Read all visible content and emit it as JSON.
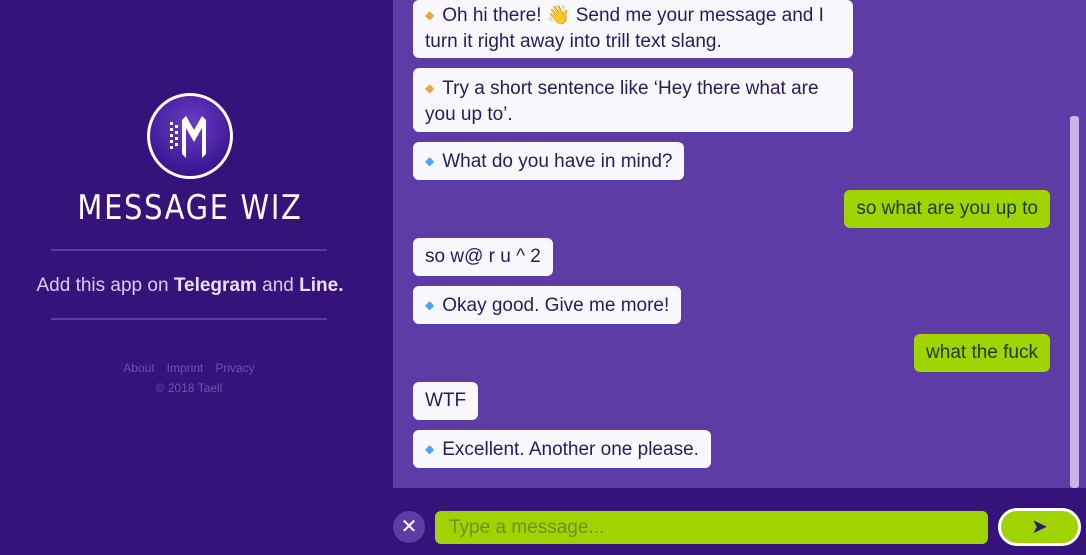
{
  "brand": {
    "name": "MESSAGE WIZ",
    "logo_icon": "message-wiz-monogram"
  },
  "sidebar": {
    "add_prefix": "Add this app on ",
    "telegram": "Telegram",
    "and": " and ",
    "line": "Line.",
    "links": [
      "About",
      "Imprint",
      "Privacy"
    ],
    "copyright": "© 2018 Taell"
  },
  "chat": {
    "messages": [
      {
        "from": "bot",
        "marker": "orange",
        "text": "Oh hi there! 👋 Send me your message and I turn it right away into trill text slang."
      },
      {
        "from": "bot",
        "marker": "orange",
        "text": "Try a short sentence like ‘Hey there what are you up to’."
      },
      {
        "from": "bot",
        "marker": "blue",
        "text": "What do you have in mind?"
      },
      {
        "from": "user",
        "text": "so what are you up to"
      },
      {
        "from": "bot",
        "marker": "none",
        "text": "so w@ r u ^ 2"
      },
      {
        "from": "bot",
        "marker": "blue",
        "text": "Okay good. Give me more!"
      },
      {
        "from": "user",
        "text": "what the fuck"
      },
      {
        "from": "bot",
        "marker": "none",
        "text": "WTF"
      },
      {
        "from": "bot",
        "marker": "blue",
        "text": "Excellent. Another one please."
      }
    ]
  },
  "input": {
    "placeholder": "Type a message...",
    "value": "",
    "clear_icon": "close-icon",
    "send_icon": "send-arrow-icon"
  },
  "colors": {
    "sidebar_bg": "#35137a",
    "chat_bg": "#5e3ca6",
    "user_bubble": "#9fd400",
    "bot_bubble": "#faf8ff",
    "orange_marker": "#f2a23a",
    "blue_marker": "#46a8e6"
  }
}
